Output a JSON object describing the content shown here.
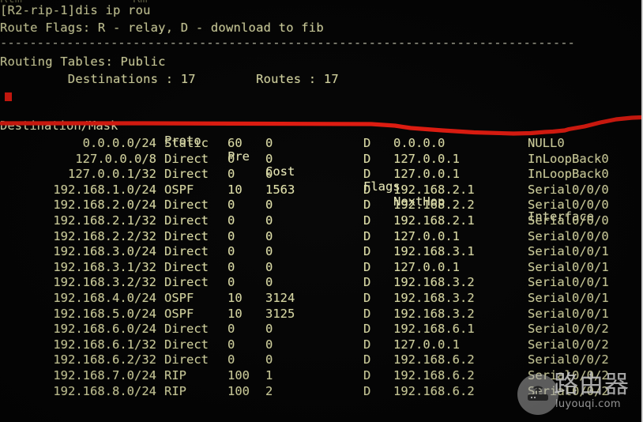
{
  "terminal": {
    "top_partial_line": "Rtm               Rm",
    "prompt_line": "[R2-rip-1]dis ip rou",
    "route_flags_line": "Route Flags: R - relay, D - download to fib",
    "separator": "------------------------------------------------------------------------------",
    "routing_tables_line": "Routing Tables: Public",
    "counts_line": "         Destinations : 17        Routes : 17",
    "destinations_label": "Destinations :",
    "destinations_value": "17",
    "routes_label": "Routes :",
    "routes_value": "17"
  },
  "table": {
    "headers": {
      "destination": "Destination/Mask",
      "proto": "Proto",
      "pre": "Pre",
      "cost": "Cost",
      "flags": "Flags",
      "nexthop": "NextHop",
      "interface": "Interface"
    },
    "rows": [
      {
        "dest": "0.0.0.0/24",
        "proto": "Static",
        "pre": "60",
        "cost": "0",
        "flags": "D",
        "nexthop": "0.0.0.0",
        "interface": "NULL0"
      },
      {
        "dest": "127.0.0.0/8",
        "proto": "Direct",
        "pre": "0",
        "cost": "0",
        "flags": "D",
        "nexthop": "127.0.0.1",
        "interface": "InLoopBack0"
      },
      {
        "dest": "127.0.0.1/32",
        "proto": "Direct",
        "pre": "0",
        "cost": "0",
        "flags": "D",
        "nexthop": "127.0.0.1",
        "interface": "InLoopBack0"
      },
      {
        "dest": "192.168.1.0/24",
        "proto": "OSPF",
        "pre": "10",
        "cost": "1563",
        "flags": "D",
        "nexthop": "192.168.2.1",
        "interface": "Serial0/0/0"
      },
      {
        "dest": "192.168.2.0/24",
        "proto": "Direct",
        "pre": "0",
        "cost": "0",
        "flags": "D",
        "nexthop": "192.168.2.2",
        "interface": "Serial0/0/0"
      },
      {
        "dest": "192.168.2.1/32",
        "proto": "Direct",
        "pre": "0",
        "cost": "0",
        "flags": "D",
        "nexthop": "192.168.2.1",
        "interface": "Serial0/0/0"
      },
      {
        "dest": "192.168.2.2/32",
        "proto": "Direct",
        "pre": "0",
        "cost": "0",
        "flags": "D",
        "nexthop": "127.0.0.1",
        "interface": "Serial0/0/0"
      },
      {
        "dest": "192.168.3.0/24",
        "proto": "Direct",
        "pre": "0",
        "cost": "0",
        "flags": "D",
        "nexthop": "192.168.3.1",
        "interface": "Serial0/0/1"
      },
      {
        "dest": "192.168.3.1/32",
        "proto": "Direct",
        "pre": "0",
        "cost": "0",
        "flags": "D",
        "nexthop": "127.0.0.1",
        "interface": "Serial0/0/1"
      },
      {
        "dest": "192.168.3.2/32",
        "proto": "Direct",
        "pre": "0",
        "cost": "0",
        "flags": "D",
        "nexthop": "192.168.3.2",
        "interface": "Serial0/0/1"
      },
      {
        "dest": "192.168.4.0/24",
        "proto": "OSPF",
        "pre": "10",
        "cost": "3124",
        "flags": "D",
        "nexthop": "192.168.3.2",
        "interface": "Serial0/0/1"
      },
      {
        "dest": "192.168.5.0/24",
        "proto": "OSPF",
        "pre": "10",
        "cost": "3125",
        "flags": "D",
        "nexthop": "192.168.3.2",
        "interface": "Serial0/0/1"
      },
      {
        "dest": "192.168.6.0/24",
        "proto": "Direct",
        "pre": "0",
        "cost": "0",
        "flags": "D",
        "nexthop": "192.168.6.1",
        "interface": "Serial0/0/2"
      },
      {
        "dest": "192.168.6.1/32",
        "proto": "Direct",
        "pre": "0",
        "cost": "0",
        "flags": "D",
        "nexthop": "127.0.0.1",
        "interface": "Serial0/0/2"
      },
      {
        "dest": "192.168.6.2/32",
        "proto": "Direct",
        "pre": "0",
        "cost": "0",
        "flags": "D",
        "nexthop": "192.168.6.2",
        "interface": "Serial0/0/2"
      },
      {
        "dest": "192.168.7.0/24",
        "proto": "RIP",
        "pre": "100",
        "cost": "1",
        "flags": "D",
        "nexthop": "192.168.6.2",
        "interface": "Serial0/0/2"
      },
      {
        "dest": "192.168.8.0/24",
        "proto": "RIP",
        "pre": "100",
        "cost": "2",
        "flags": "D",
        "nexthop": "192.168.6.2",
        "interface": "Serial0/0/2"
      }
    ]
  },
  "annotation": {
    "color": "#f01c10",
    "description": "hand-drawn red underline beneath the column header row"
  },
  "watermark": {
    "chinese_text": "路由器",
    "url": "luyouqi.com",
    "icon": "router-wifi-icon"
  },
  "colors": {
    "background": "#040404",
    "text": "#e8e8b0",
    "annotation_red": "#f01c10"
  }
}
